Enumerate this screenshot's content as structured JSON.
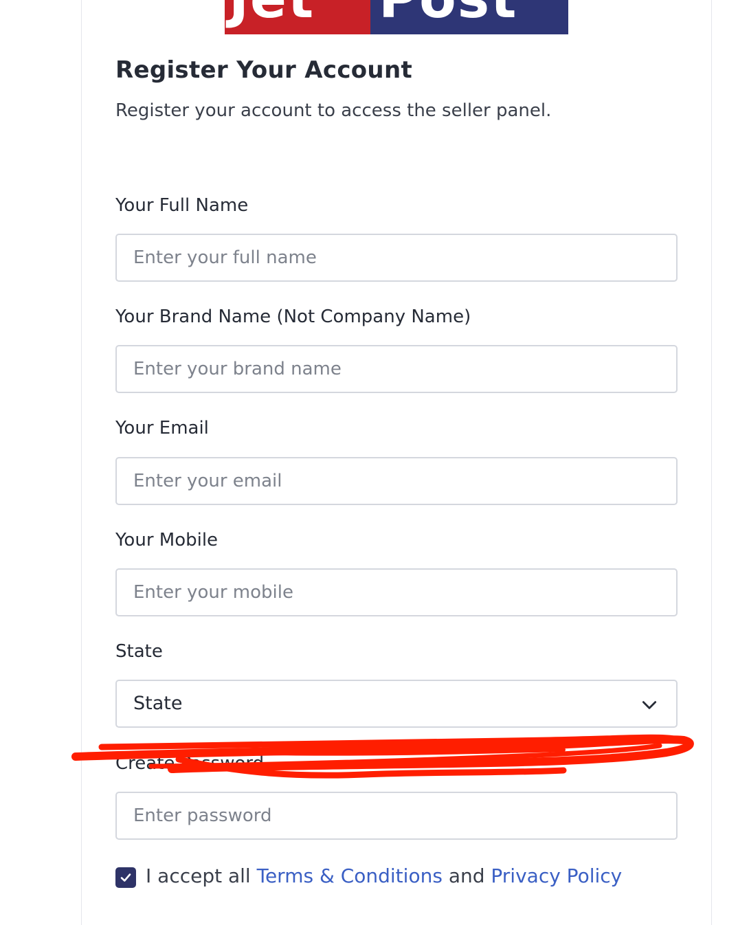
{
  "logo": {
    "left_text": "Jet",
    "right_text": "Post",
    "colors": {
      "left_bg": "#c82127",
      "right_bg": "#2e3676"
    }
  },
  "header": {
    "title": "Register Your Account",
    "subtitle": "Register your account to access the seller panel."
  },
  "form": {
    "full_name": {
      "label": "Your Full Name",
      "placeholder": "Enter your full name",
      "value": ""
    },
    "brand_name": {
      "label": "Your Brand Name (Not Company Name)",
      "placeholder": "Enter your brand name",
      "value": ""
    },
    "email": {
      "label": "Your Email",
      "placeholder": "Enter your email",
      "value": ""
    },
    "mobile": {
      "label": "Your Mobile",
      "placeholder": "Enter your mobile",
      "value": ""
    },
    "state": {
      "label": "State",
      "selected": "State",
      "icon": "chevron-down-icon"
    },
    "password": {
      "label": "Create Password",
      "placeholder": "Enter password",
      "value": ""
    },
    "terms": {
      "checked": true,
      "prefix": "I accept all",
      "terms_link": "Terms & Conditions",
      "joiner": "and",
      "privacy_link": "Privacy Policy"
    }
  },
  "annotation": {
    "color": "#ff1e00"
  },
  "colors": {
    "link": "#3a5fc4",
    "checkbox": "#2e3367"
  }
}
